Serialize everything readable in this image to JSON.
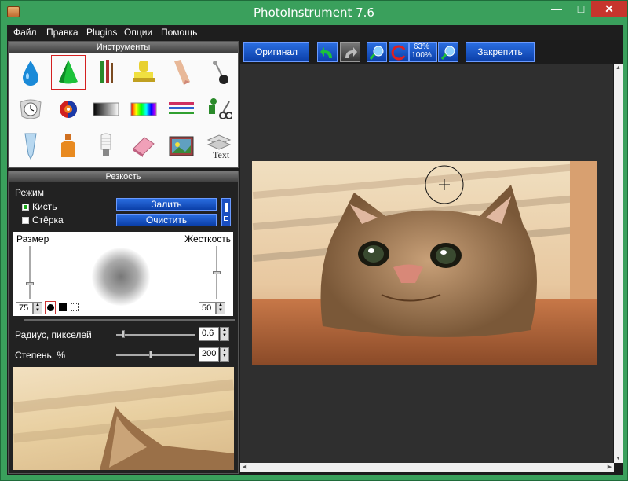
{
  "window": {
    "title": "PhotoInstrument 7.6",
    "min": "—",
    "max": "□",
    "close": "✕"
  },
  "menu": [
    "Файл",
    "Правка",
    "Plugins",
    "Опции",
    "Помощь"
  ],
  "toolbar": {
    "original": "Оригинал",
    "zoom_top": "63%",
    "zoom_bottom": "100%",
    "pin": "Закрепить"
  },
  "tools_panel": {
    "title": "Инструменты",
    "tools": [
      "drop-icon",
      "cone-icon",
      "brushes-icon",
      "stamp-icon",
      "finger-icon",
      "pin-icon",
      "clock-icon",
      "color-wheel-icon",
      "gradient-icon",
      "rainbow-icon",
      "lines-icon",
      "scissors-icon",
      "tube-icon",
      "bottle-icon",
      "bulb-icon",
      "eraser-icon",
      "photo-icon",
      "text-layers-icon"
    ],
    "selected": 1
  },
  "sharpen_panel": {
    "title": "Резкость",
    "mode_label": "Режим",
    "brush_label": "Кисть",
    "eraser_label": "Стёрка",
    "fill_button": "Залить",
    "clear_button": "Очистить",
    "size_label": "Размер",
    "hardness_label": "Жесткость",
    "size_value": "75",
    "hardness_value": "50",
    "radius_label": "Радиус, пикселей",
    "radius_value": "0.6",
    "strength_label": "Степень, %",
    "strength_value": "200"
  },
  "colors": {
    "accent": "#0b3fa8",
    "frame": "#3aa05c",
    "close": "#c7352d"
  }
}
